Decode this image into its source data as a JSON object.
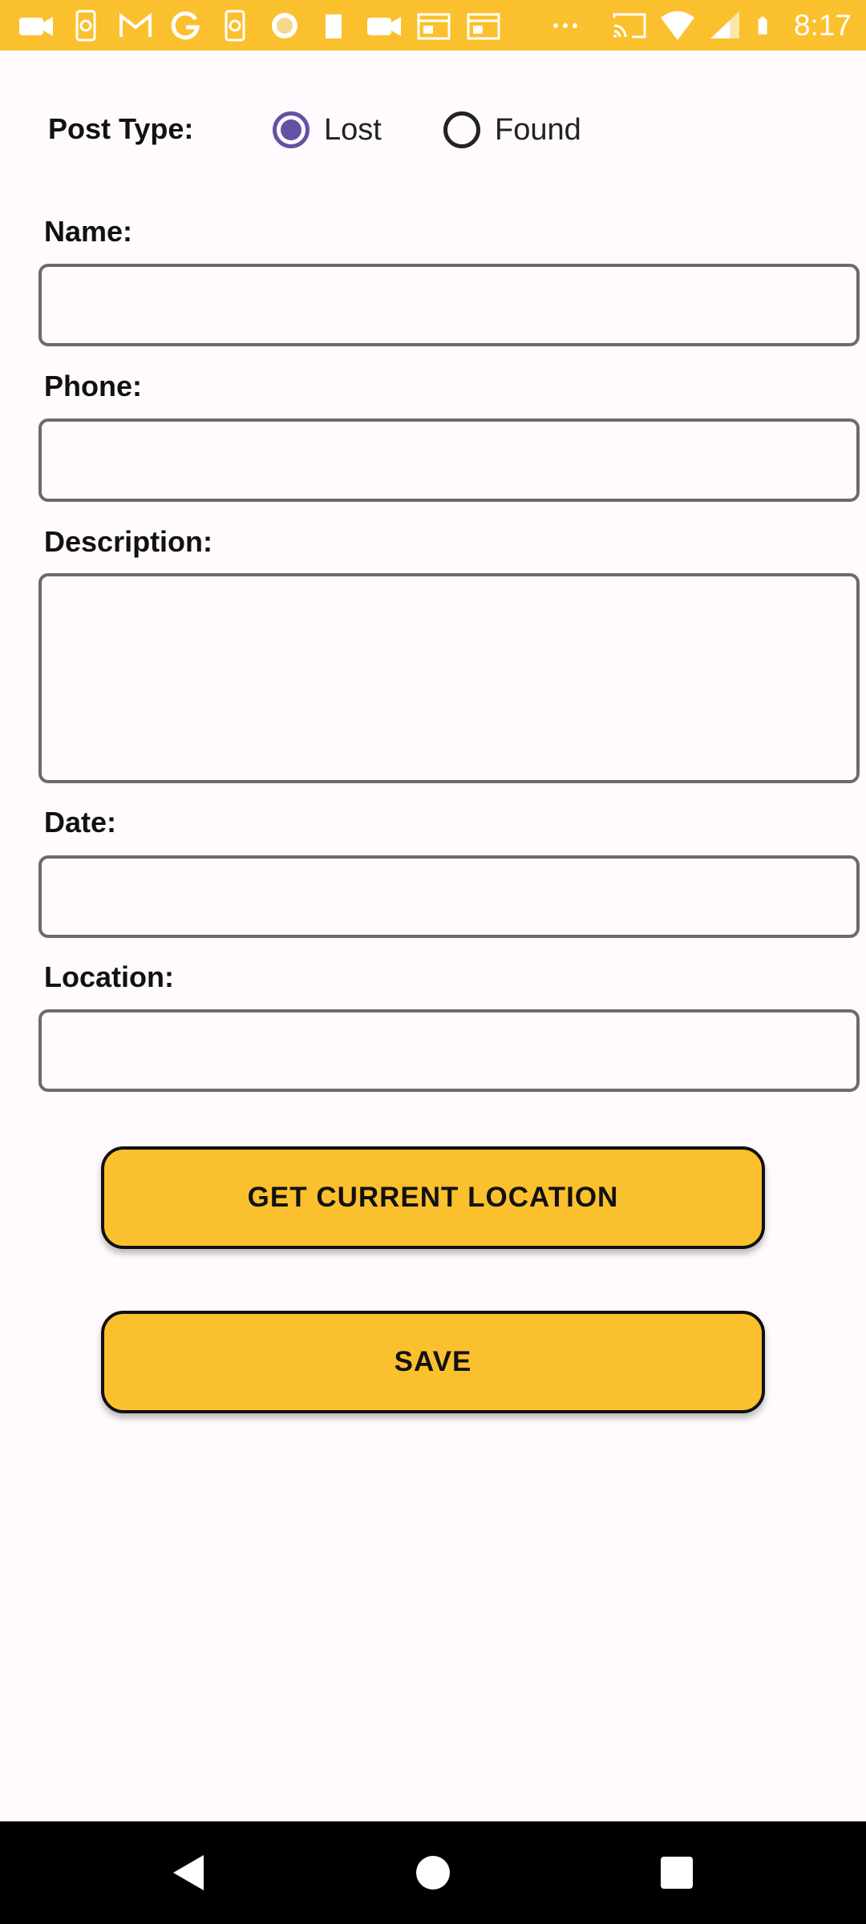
{
  "status_bar": {
    "time": "8:17",
    "left_icons": [
      "video-icon",
      "podcast-icon",
      "gmail-icon",
      "google-icon",
      "podcast-icon",
      "circle-icon",
      "sd-card-icon",
      "video-icon",
      "calendar-icon",
      "calendar-icon",
      "more-dots-icon"
    ],
    "right_icons": [
      "cast-icon",
      "wifi-icon",
      "signal-icon",
      "battery-icon"
    ]
  },
  "form": {
    "post_type_label": "Post Type:",
    "options": [
      {
        "label": "Lost",
        "checked": true
      },
      {
        "label": "Found",
        "checked": false
      }
    ],
    "name_label": "Name:",
    "name_value": "",
    "phone_label": "Phone:",
    "phone_value": "",
    "description_label": "Description:",
    "description_value": "",
    "date_label": "Date:",
    "date_value": "",
    "location_label": "Location:",
    "location_value": ""
  },
  "buttons": {
    "get_location": "GET CURRENT LOCATION",
    "save": "SAVE"
  },
  "colors": {
    "accent": "#fbc02d",
    "radio": "#6650a4",
    "background": "#fefafd"
  }
}
